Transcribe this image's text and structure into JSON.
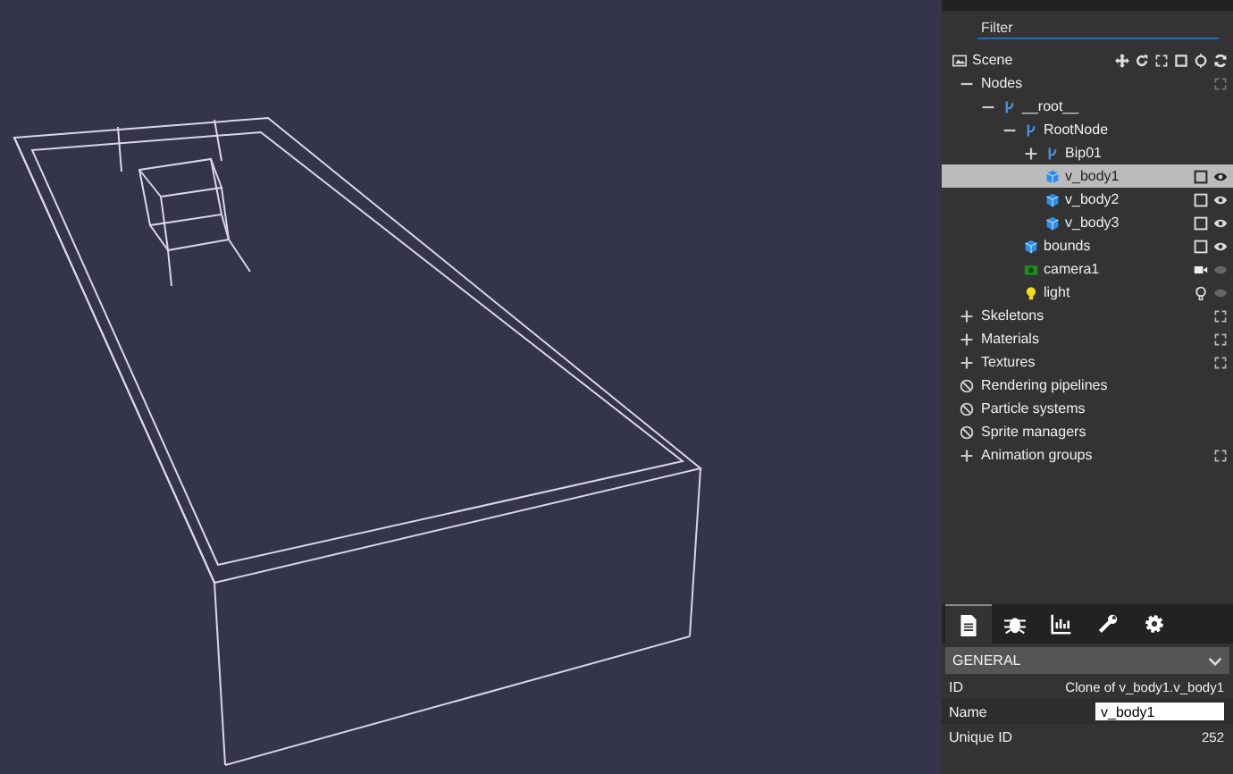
{
  "inspector": {
    "filter": {
      "placeholder": "Filter"
    },
    "scene": {
      "label": "Scene"
    },
    "tree": [
      {
        "label": "Nodes",
        "kind": "group",
        "expanded": true,
        "selected": false,
        "children": [
          {
            "label": "__root__",
            "kind": "transform",
            "expanded": true,
            "selected": false,
            "children": [
              {
                "label": "RootNode",
                "kind": "transform",
                "expanded": true,
                "selected": false,
                "children": [
                  {
                    "label": "Bip01",
                    "kind": "transform",
                    "expanded": false,
                    "selected": false
                  },
                  {
                    "label": "v_body1",
                    "kind": "mesh",
                    "selected": true
                  },
                  {
                    "label": "v_body2",
                    "kind": "mesh",
                    "selected": false
                  },
                  {
                    "label": "v_body3",
                    "kind": "mesh",
                    "selected": false
                  }
                ]
              },
              {
                "label": "bounds",
                "kind": "mesh",
                "selected": false
              },
              {
                "label": "camera1",
                "kind": "camera",
                "selected": false
              },
              {
                "label": "light",
                "kind": "light",
                "selected": false
              }
            ]
          }
        ]
      }
    ],
    "sections": [
      {
        "label": "Skeletons",
        "kind": "collapsed"
      },
      {
        "label": "Materials",
        "kind": "collapsed"
      },
      {
        "label": "Textures",
        "kind": "collapsed"
      },
      {
        "label": "Rendering pipelines",
        "kind": "disabled"
      },
      {
        "label": "Particle systems",
        "kind": "disabled"
      },
      {
        "label": "Sprite managers",
        "kind": "disabled"
      },
      {
        "label": "Animation groups",
        "kind": "collapsed"
      }
    ],
    "tabs": [
      {
        "kind": "properties",
        "selected": true
      },
      {
        "kind": "debug",
        "selected": false
      },
      {
        "kind": "statistics",
        "selected": false
      },
      {
        "kind": "tools",
        "selected": false
      },
      {
        "kind": "settings",
        "selected": false
      }
    ],
    "properties": {
      "section": "GENERAL",
      "rows": [
        {
          "label": "ID",
          "kind": "text",
          "value": "Clone of v_body1.v_body1"
        },
        {
          "label": "Name",
          "kind": "input",
          "value": "v_body1"
        },
        {
          "label": "Unique ID",
          "kind": "text",
          "value": "252"
        }
      ]
    }
  }
}
